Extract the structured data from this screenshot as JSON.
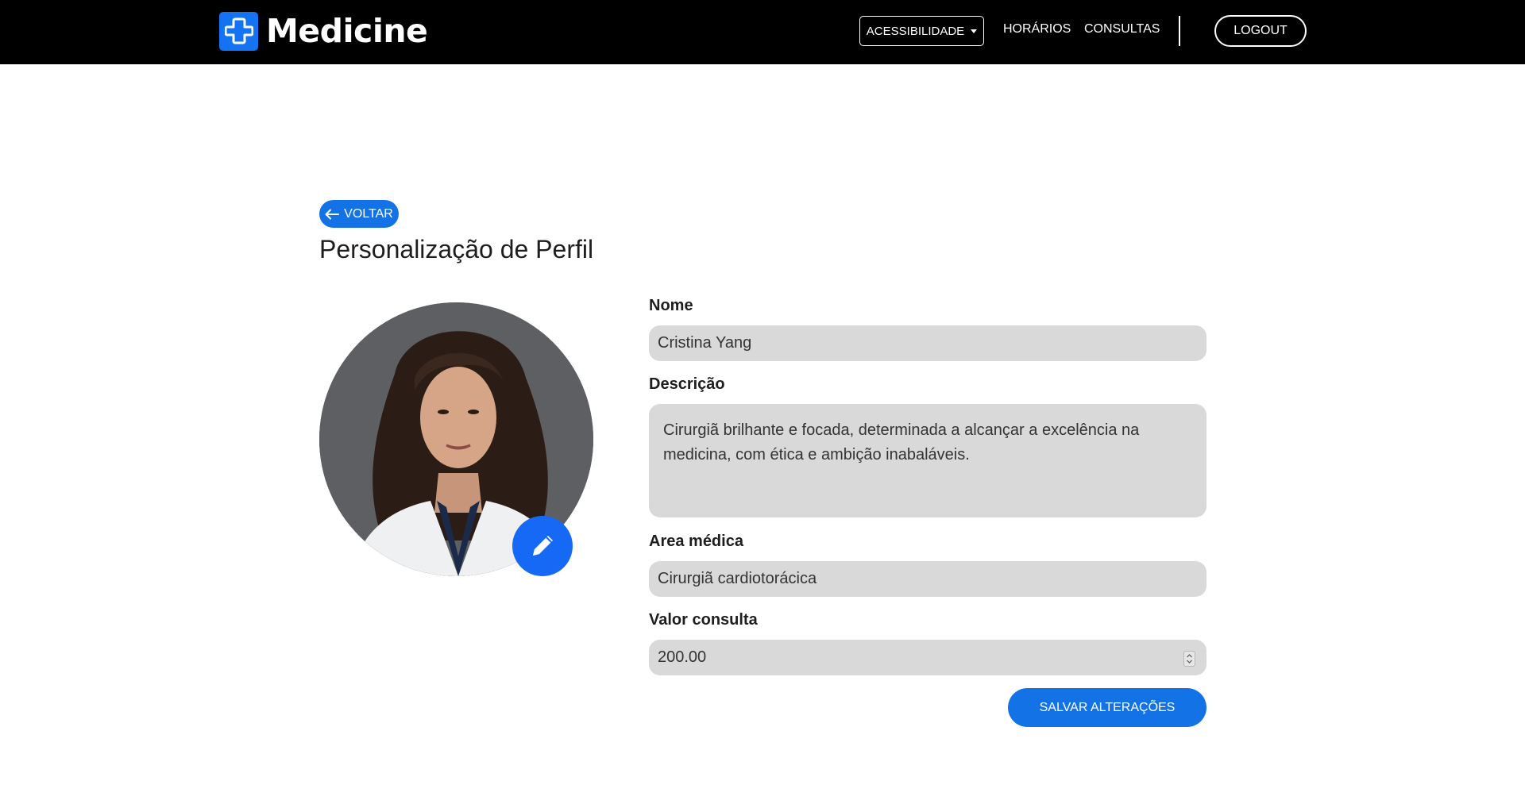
{
  "brand": {
    "name": "Medicine",
    "logo_icon": "medical-cross-icon"
  },
  "nav": {
    "accessibility_label": "ACESSIBILIDADE",
    "horarios_label": "HORÁRIOS",
    "consultas_label": "CONSULTAS",
    "logout_label": "LOGOUT"
  },
  "page": {
    "back_label": "VOLTAR",
    "title": "Personalização de Perfil"
  },
  "form": {
    "nome": {
      "label": "Nome",
      "value": "Cristina Yang"
    },
    "descricao": {
      "label": "Descrição",
      "value": "Cirurgiã brilhante e focada, determinada a alcançar a excelência na medicina, com ética e ambição inabaláveis."
    },
    "area": {
      "label": "Area médica",
      "value": "Cirurgiã cardiotorácica"
    },
    "valor": {
      "label": "Valor consulta",
      "value": "200.00"
    },
    "save_label": "SALVAR ALTERAÇÕES"
  },
  "colors": {
    "navbar": "#000000",
    "accent": "#1373e6",
    "field_bg": "#d9d9d9"
  }
}
